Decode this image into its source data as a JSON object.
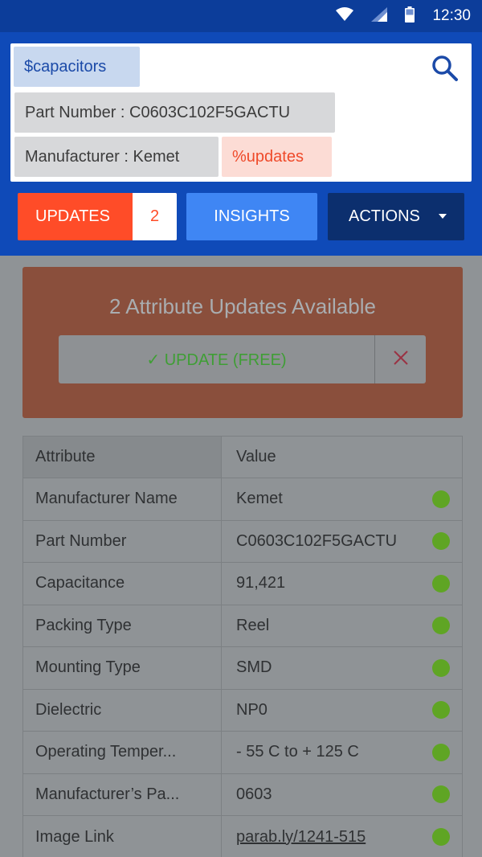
{
  "status_bar": {
    "time": "12:30",
    "icons": [
      "wifi-icon",
      "signal-icon",
      "battery-icon"
    ]
  },
  "search": {
    "query_chip": "$capacitors",
    "part_number_chip": "Part Number : C0603C102F5GACTU",
    "manufacturer_chip": "Manufacturer : Kemet",
    "updates_chip": "%updates",
    "search_icon": "search-icon"
  },
  "toolbar": {
    "updates_label": "UPDATES",
    "updates_count": "2",
    "insights_label": "INSIGHTS",
    "actions_label": "ACTIONS"
  },
  "update_card": {
    "title": "2 Attribute Updates Available",
    "update_label": "✓ UPDATE (FREE)",
    "dismiss_icon": "close-icon"
  },
  "table": {
    "headers": [
      "Attribute",
      "Value"
    ],
    "rows": [
      {
        "attribute": "Manufacturer Name",
        "value": "Kemet"
      },
      {
        "attribute": "Part Number",
        "value": "C0603C102F5GACTU"
      },
      {
        "attribute": "Capacitance",
        "value": "91,421"
      },
      {
        "attribute": "Packing Type",
        "value": "Reel"
      },
      {
        "attribute": "Mounting Type",
        "value": "SMD"
      },
      {
        "attribute": "Dielectric",
        "value": "NP0"
      },
      {
        "attribute": "Operating Temper...",
        "value": "- 55 C to + 125 C"
      },
      {
        "attribute": "Manufacturer’s Pa...",
        "value": "0603"
      },
      {
        "attribute": "Image Link",
        "value": "parab.ly/1241-515"
      }
    ]
  },
  "colors": {
    "header_blue": "#0f4ab8",
    "status_blue": "#0c3d9a",
    "updates_orange": "#ff4c28",
    "insights_blue": "#3f86f4",
    "actions_navy": "#0c2f6e",
    "status_green": "#5fa524"
  }
}
